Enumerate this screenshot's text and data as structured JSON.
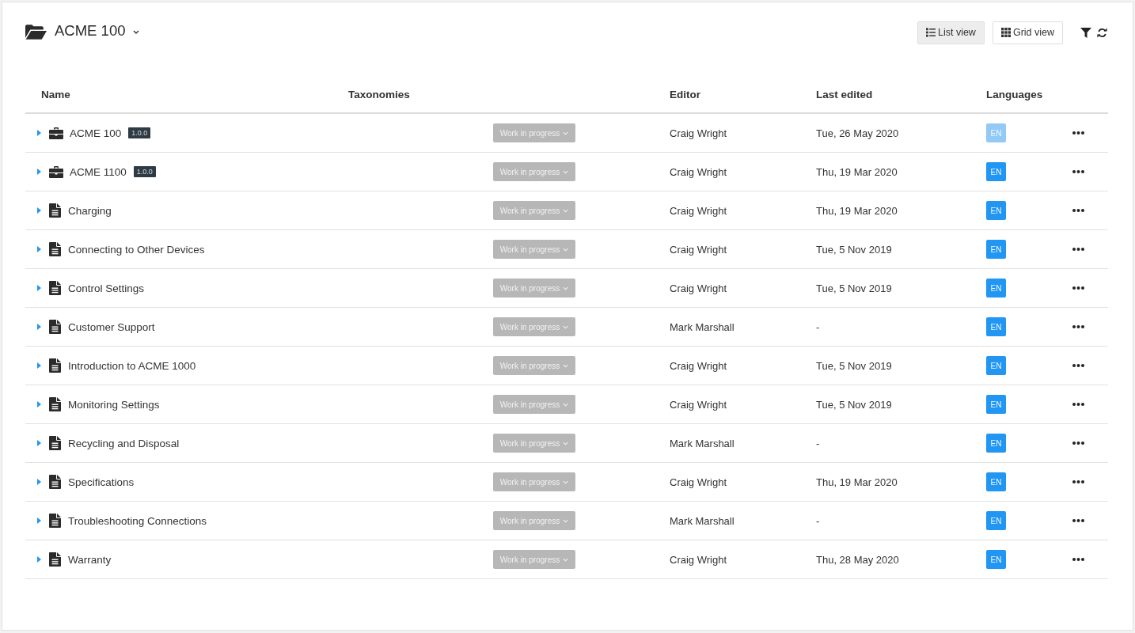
{
  "header": {
    "title": "ACME 100"
  },
  "view_buttons": [
    {
      "kind": "list",
      "label": "List view",
      "selected": true
    },
    {
      "kind": "grid",
      "label": "Grid view",
      "selected": false
    }
  ],
  "table": {
    "columns": [
      "Name",
      "Taxonomies",
      "Editor",
      "Last edited",
      "Languages"
    ],
    "rows": [
      {
        "kind": "product",
        "expanded": false,
        "name": "ACME 100",
        "version": "1.0.0",
        "status": "Work in progress",
        "editor": "Craig Wright",
        "last_edited": "Tue, 26 May 2020",
        "language": {
          "code": "EN",
          "disabled": true
        }
      },
      {
        "kind": "product",
        "expanded": false,
        "name": "ACME 1100",
        "version": "1.0.0",
        "status": "Work in progress",
        "editor": "Craig Wright",
        "last_edited": "Thu, 19 Mar 2020",
        "language": {
          "code": "EN",
          "disabled": false
        }
      },
      {
        "kind": "document",
        "expanded": false,
        "name": "Charging",
        "status": "Work in progress",
        "editor": "Craig Wright",
        "last_edited": "Thu, 19 Mar 2020",
        "language": {
          "code": "EN",
          "disabled": false
        }
      },
      {
        "kind": "document",
        "expanded": false,
        "name": "Connecting to Other Devices",
        "status": "Work in progress",
        "editor": "Craig Wright",
        "last_edited": "Tue, 5 Nov 2019",
        "language": {
          "code": "EN",
          "disabled": false
        }
      },
      {
        "kind": "document",
        "expanded": false,
        "name": "Control Settings",
        "status": "Work in progress",
        "editor": "Craig Wright",
        "last_edited": "Tue, 5 Nov 2019",
        "language": {
          "code": "EN",
          "disabled": false
        }
      },
      {
        "kind": "document",
        "expanded": false,
        "name": "Customer Support",
        "status": "Work in progress",
        "editor": "Mark Marshall",
        "last_edited": "-",
        "language": {
          "code": "EN",
          "disabled": false
        }
      },
      {
        "kind": "document",
        "expanded": false,
        "name": "Introduction to ACME 1000",
        "status": "Work in progress",
        "editor": "Craig Wright",
        "last_edited": "Tue, 5 Nov 2019",
        "language": {
          "code": "EN",
          "disabled": false
        }
      },
      {
        "kind": "document",
        "expanded": false,
        "name": "Monitoring Settings",
        "status": "Work in progress",
        "editor": "Craig Wright",
        "last_edited": "Tue, 5 Nov 2019",
        "language": {
          "code": "EN",
          "disabled": false
        }
      },
      {
        "kind": "document",
        "expanded": false,
        "name": "Recycling and Disposal",
        "status": "Work in progress",
        "editor": "Mark Marshall",
        "last_edited": "-",
        "language": {
          "code": "EN",
          "disabled": false
        }
      },
      {
        "kind": "document",
        "expanded": false,
        "name": "Specifications",
        "status": "Work in progress",
        "editor": "Craig Wright",
        "last_edited": "Thu, 19 Mar 2020",
        "language": {
          "code": "EN",
          "disabled": false
        }
      },
      {
        "kind": "document",
        "expanded": false,
        "name": "Troubleshooting Connections",
        "status": "Work in progress",
        "editor": "Mark Marshall",
        "last_edited": "-",
        "language": {
          "code": "EN",
          "disabled": false
        }
      },
      {
        "kind": "document",
        "expanded": false,
        "name": "Warranty",
        "status": "Work in progress",
        "editor": "Craig Wright",
        "last_edited": "Thu, 28 May 2020",
        "language": {
          "code": "EN",
          "disabled": false
        }
      }
    ]
  }
}
